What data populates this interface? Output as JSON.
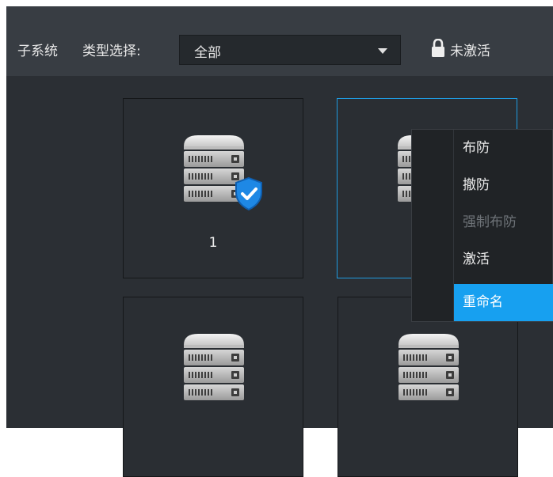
{
  "toolbar": {
    "subsystem_label": "子系统",
    "type_label": "类型选择:",
    "type_select": {
      "value": "全部"
    },
    "status": {
      "label": "未激活",
      "icon": "lock-icon"
    }
  },
  "tiles": [
    {
      "name": "1",
      "icon": "server-icon",
      "badge": "shield-check-icon",
      "selected": false
    },
    {
      "name": "",
      "icon": "server-icon",
      "selected": true
    },
    {
      "name": "",
      "icon": "server-icon",
      "selected": false
    },
    {
      "name": "",
      "icon": "server-icon",
      "selected": false
    }
  ],
  "context_menu": {
    "items": [
      {
        "label": "布防",
        "enabled": true
      },
      {
        "label": "撤防",
        "enabled": true
      },
      {
        "label": "强制布防",
        "enabled": false
      },
      {
        "label": "激活",
        "enabled": true
      },
      {
        "label": "重命名",
        "enabled": true,
        "highlighted": true
      }
    ]
  },
  "colors": {
    "toolbar_bg": "#383d43",
    "content_bg": "#2b2f34",
    "selection_border": "#1f9be0",
    "menu_highlight": "#17a0f0",
    "badge_blue": "#1e88e5"
  }
}
